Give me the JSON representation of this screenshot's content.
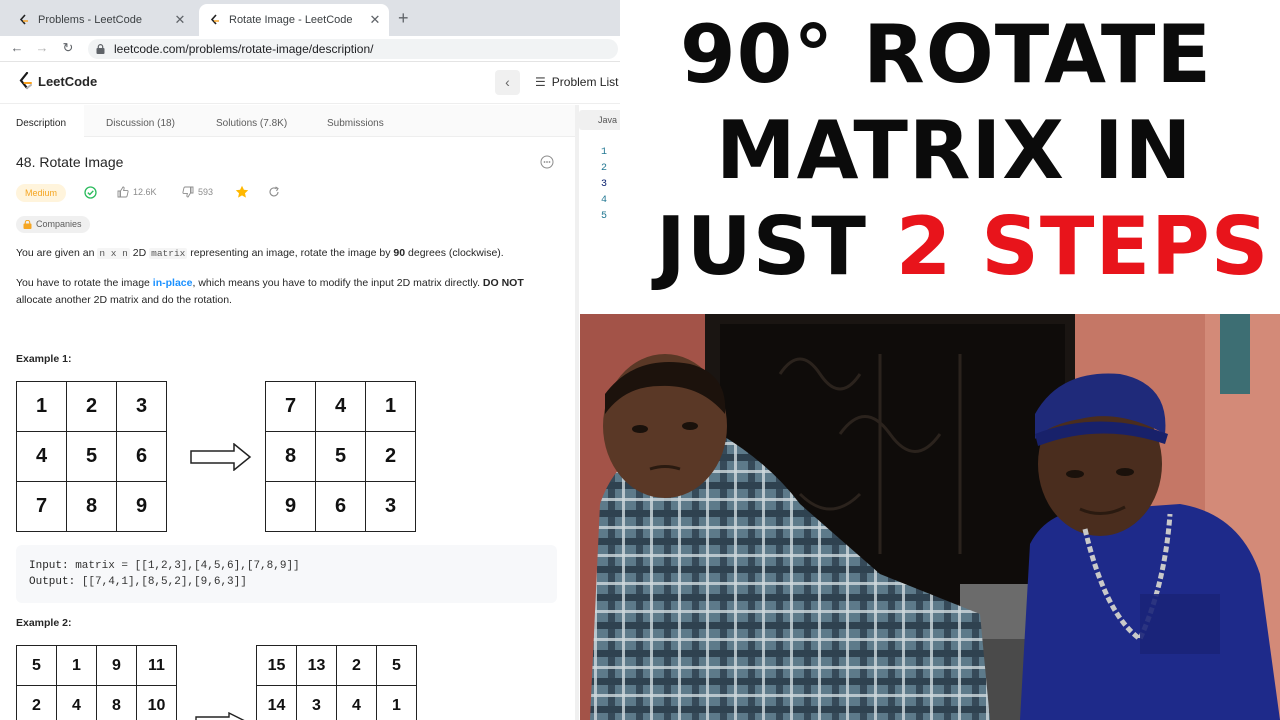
{
  "browser": {
    "tabs": [
      {
        "title": "Problems - LeetCode",
        "active": false
      },
      {
        "title": "Rotate Image - LeetCode",
        "active": true
      }
    ],
    "new_tab_glyph": "+",
    "url": "leetcode.com/problems/rotate-image/description/"
  },
  "header": {
    "logo_text": "LeetCode",
    "problem_list_label": "Problem List"
  },
  "description_tabs": [
    "Description",
    "Discussion (18)",
    "Solutions (7.8K)",
    "Submissions"
  ],
  "problem": {
    "title": "48. Rotate Image",
    "difficulty": "Medium",
    "likes": "12.6K",
    "dislikes": "593",
    "companies_label": "Companies",
    "para1": {
      "pre": "You are given an ",
      "code1": "n x n",
      "mid": " 2D ",
      "code2": "matrix",
      "post": " representing an image, rotate the image by ",
      "bold": "90",
      "end": " degrees (clockwise)."
    },
    "para2": {
      "pre": "You have to rotate the image ",
      "link": "in-place",
      "mid": ", which means you have to modify the input 2D matrix directly. ",
      "bold": "DO NOT",
      "end": " allocate another 2D matrix and do the rotation."
    },
    "example1": {
      "title": "Example 1:",
      "input_grid": [
        "1",
        "2",
        "3",
        "4",
        "5",
        "6",
        "7",
        "8",
        "9"
      ],
      "output_grid": [
        "7",
        "4",
        "1",
        "8",
        "5",
        "2",
        "9",
        "6",
        "3"
      ],
      "input_label": "Input:",
      "input_value": " matrix = [[1,2,3],[4,5,6],[7,8,9]]",
      "output_label": "Output:",
      "output_value": " [[7,4,1],[8,5,2],[9,6,3]]"
    },
    "example2": {
      "title": "Example 2:",
      "input_grid": [
        "5",
        "1",
        "9",
        "11",
        "2",
        "4",
        "8",
        "10"
      ],
      "output_grid": [
        "15",
        "13",
        "2",
        "5",
        "14",
        "3",
        "4",
        "1"
      ]
    }
  },
  "editor": {
    "language": "Java",
    "line_numbers": [
      "1",
      "2",
      "3",
      "4",
      "5"
    ]
  },
  "headline": {
    "line1": "90° ROTATE",
    "line2": "MATRIX IN",
    "line3_black": "JUST ",
    "line3_red": "2 STEPS"
  },
  "colors": {
    "headline_red": "#e8141b",
    "medium_badge": "#f5a623",
    "link_blue": "#1a90ff",
    "star": "#ffb800",
    "check": "#2cbb5d"
  }
}
